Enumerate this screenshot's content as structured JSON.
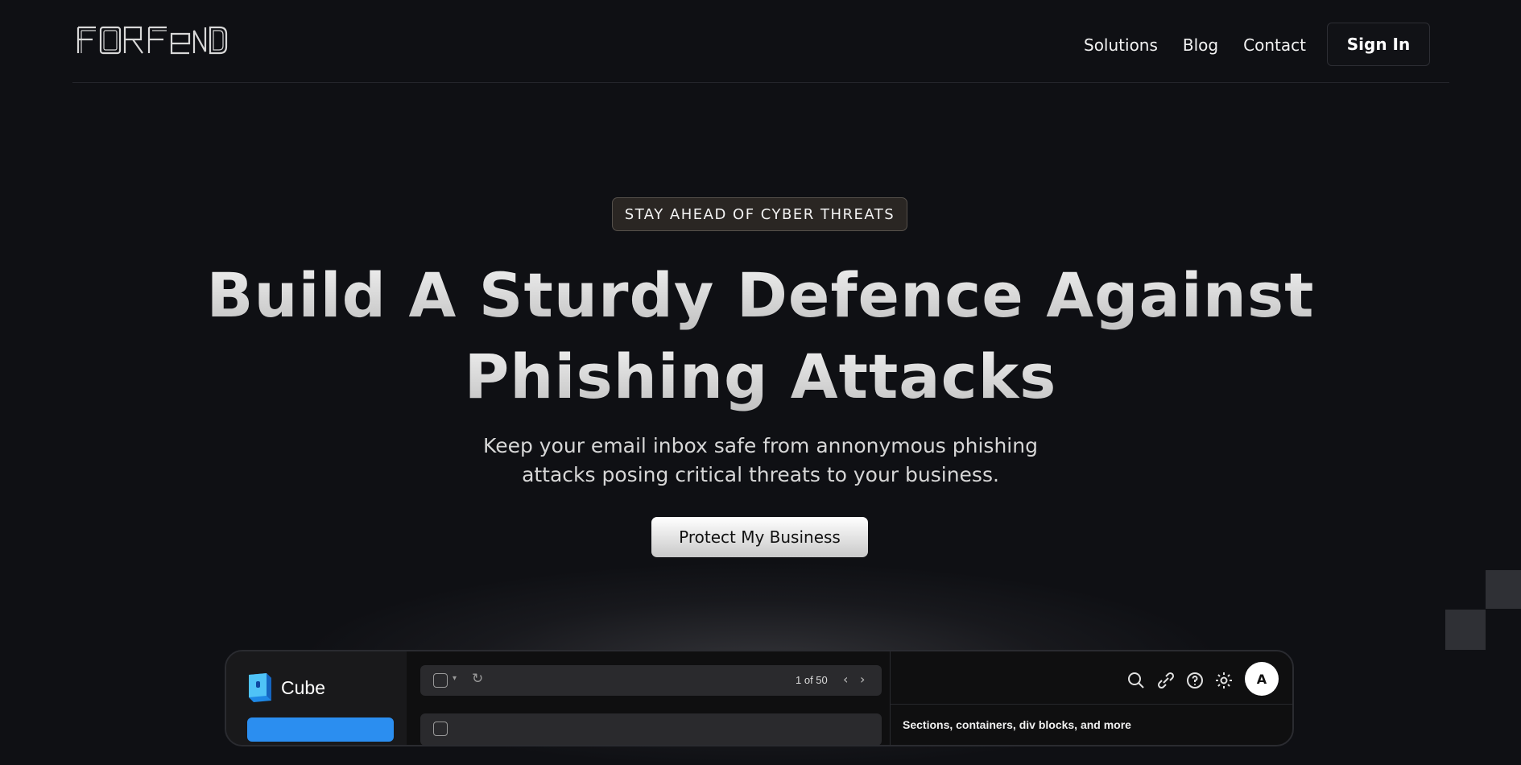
{
  "nav": {
    "logo_text": "FORFEND",
    "links": [
      "Solutions",
      "Blog",
      "Contact"
    ],
    "signin_label": "Sign In"
  },
  "hero": {
    "badge": "STAY AHEAD OF CYBER THREATS",
    "headline_line1": "Build A Sturdy Defence Against",
    "headline_line2": "Phishing Attacks",
    "sub_line1": "Keep your email inbox safe from annonymous phishing",
    "sub_line2": "attacks posing critical threats to your business.",
    "cta_label": "Protect My Business"
  },
  "app_preview": {
    "brand": "Cube",
    "pagination": "1 of 50",
    "avatar_initial": "A",
    "preview_title": "Sections, containers, div blocks, and more",
    "icons": [
      "search-icon",
      "link-icon",
      "help-icon",
      "settings-icon"
    ]
  },
  "colors": {
    "background": "#0f1014",
    "badge_bg": "#2a2623",
    "compose_blue": "#2b8ef0",
    "text_primary": "#f2f2f2"
  }
}
